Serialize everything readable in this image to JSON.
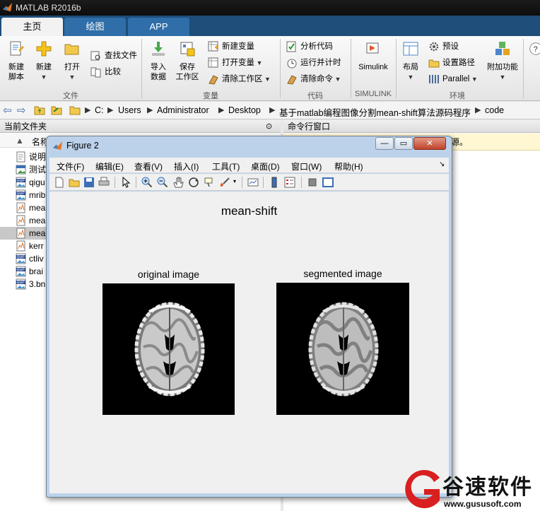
{
  "app": {
    "title": "MATLAB R2016b"
  },
  "tabs": [
    {
      "label": "主页"
    },
    {
      "label": "绘图"
    },
    {
      "label": "APP"
    }
  ],
  "ribbon": {
    "file_group": {
      "label": "文件",
      "new_script": "新建\n脚本",
      "new": "新建",
      "open": "打开",
      "find_files": "查找文件",
      "compare": "比较"
    },
    "variable_group": {
      "label": "变量",
      "import": "导入\n数据",
      "save_ws": "保存\n工作区",
      "new_var": "新建变量",
      "open_var": "打开变量",
      "clear_ws": "清除工作区"
    },
    "code_group": {
      "label": "代码",
      "analyze": "分析代码",
      "run_time": "运行并计时",
      "clear_cmd": "清除命令"
    },
    "simulink_group": {
      "label": "SIMULINK",
      "simulink": "Simulink"
    },
    "env_group": {
      "label": "环境",
      "layout": "布局",
      "prefs": "预设",
      "set_path": "设置路径",
      "parallel": "Parallel",
      "addons": "附加功能"
    }
  },
  "address": {
    "path": [
      "C:",
      "Users",
      "Administrator",
      "Desktop",
      "基于matlab编程图像分割mean-shift算法源码程序",
      "code"
    ]
  },
  "left_panel": {
    "title": "当前文件夹",
    "column_name": "名称",
    "files": [
      {
        "name": "说明",
        "icon": "text-file-icon"
      },
      {
        "name": "测试",
        "icon": "image-file-icon"
      },
      {
        "name": "qigu",
        "icon": "bmp-file-icon"
      },
      {
        "name": "mrib",
        "icon": "bmp-file-icon"
      },
      {
        "name": "mea",
        "icon": "m-file-icon"
      },
      {
        "name": "mea",
        "icon": "m-file-icon"
      },
      {
        "name": "mea",
        "icon": "m-file-icon",
        "selected": true
      },
      {
        "name": "kerr",
        "icon": "m-file-icon"
      },
      {
        "name": "ctliv",
        "icon": "bmp-file-icon"
      },
      {
        "name": "brai",
        "icon": "bmp-file-icon"
      },
      {
        "name": "3.bn",
        "icon": "bmp-file-icon"
      }
    ]
  },
  "right_panel": {
    "title": "命令行窗口",
    "banner": "源。"
  },
  "figure": {
    "title": "Figure 2",
    "menus": [
      "文件(F)",
      "编辑(E)",
      "查看(V)",
      "插入(I)",
      "工具(T)",
      "桌面(D)",
      "窗口(W)",
      "帮助(H)"
    ],
    "suptitle": "mean-shift",
    "axes_titles": [
      "original image",
      "segmented image"
    ]
  },
  "watermark": {
    "brand": "谷速软件",
    "url": "www.gususoft.com"
  },
  "colors": {
    "tab_bg": "#1e4e79",
    "tab_inactive": "#2f6ea8",
    "titlebar": "#111111",
    "figure_frame": "#bcd2ea",
    "close_btn": "#c0422a"
  }
}
